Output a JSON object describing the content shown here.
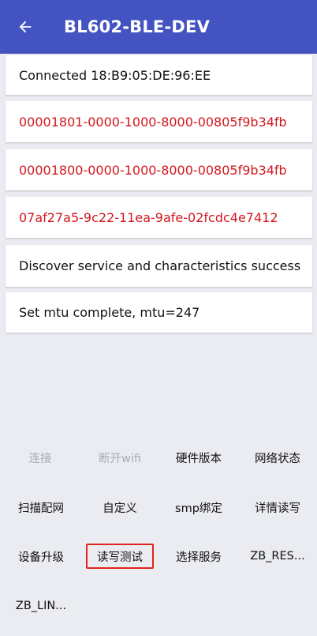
{
  "appbar": {
    "title": "BL602-BLE-DEV",
    "back_icon": "arrow-left-icon",
    "color": "#4353c2"
  },
  "messages": [
    {
      "text": "Connected 18:B9:05:DE:96:EE",
      "color": "#111111"
    },
    {
      "text": "00001801-0000-1000-8000-00805f9b34fb",
      "color": "#d4161d"
    },
    {
      "text": "00001800-0000-1000-8000-00805f9b34fb",
      "color": "#d4161d"
    },
    {
      "text": "07af27a5-9c22-11ea-9afe-02fcdc4e7412",
      "color": "#d4161d"
    },
    {
      "text": "Discover service and characteristics success",
      "color": "#111111"
    },
    {
      "text": "Set mtu complete, mtu=247",
      "color": "#111111"
    }
  ],
  "buttons": [
    {
      "label": "连接",
      "enabled": false
    },
    {
      "label": "断开wifi",
      "enabled": false
    },
    {
      "label": "硬件版本",
      "enabled": true
    },
    {
      "label": "网络状态",
      "enabled": true
    },
    {
      "label": "扫描配网",
      "enabled": true
    },
    {
      "label": "自定义",
      "enabled": true
    },
    {
      "label": "smp绑定",
      "enabled": true
    },
    {
      "label": "详情读写",
      "enabled": true
    },
    {
      "label": "设备升级",
      "enabled": true
    },
    {
      "label": "读写测试",
      "enabled": true,
      "highlighted": true
    },
    {
      "label": "选择服务",
      "enabled": true
    },
    {
      "label": "ZB_RES...",
      "enabled": true
    },
    {
      "label": "ZB_LIN...",
      "enabled": true
    }
  ],
  "highlight_color": "#e5231a"
}
